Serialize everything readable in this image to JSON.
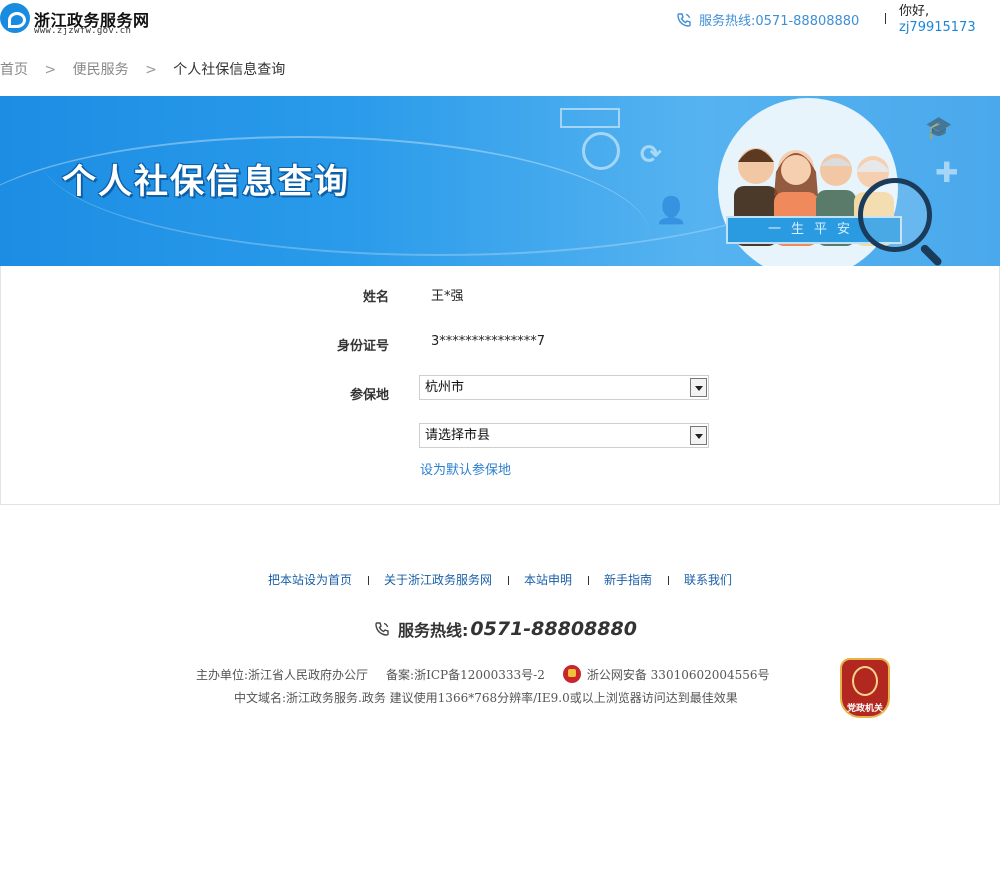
{
  "header": {
    "logo_title": "浙江政务服务网",
    "logo_url": "www.zjzwfw.gov.cn",
    "hotline": "服务热线:0571-88808880",
    "greeting": "你好,",
    "username": "zj79915173"
  },
  "breadcrumb": {
    "items": [
      "首页",
      "便民服务"
    ],
    "separator": ">",
    "current": "个人社保信息查询"
  },
  "banner": {
    "title": "个人社保信息查询",
    "ribbon": "一生平安"
  },
  "form": {
    "name_label": "姓名",
    "name_value": "王*强",
    "id_label": "身份证号",
    "id_value": "3***************7",
    "region_label": "参保地",
    "city_select": "杭州市",
    "county_select": "请选择市县",
    "set_default_link": "设为默认参保地"
  },
  "footer": {
    "links": [
      "把本站设为首页",
      "关于浙江政务服务网",
      "本站申明",
      "新手指南",
      "联系我们"
    ],
    "hotline_label": "服务热线:",
    "hotline_number": "0571-88808880",
    "sponsor": "主办单位:浙江省人民政府办公厅",
    "icp": "备案:浙ICP备12000333号-2",
    "police_record": "浙公网安备 33010602004556号",
    "domain_note": "中文域名:浙江政务服务.政务 建议使用1366*768分辨率/IE9.0或以上浏览器访问达到最佳效果",
    "badge_text": "党政机关"
  },
  "colors": {
    "link_blue": "#1a86d7",
    "banner_blue": "#2a9bea"
  }
}
